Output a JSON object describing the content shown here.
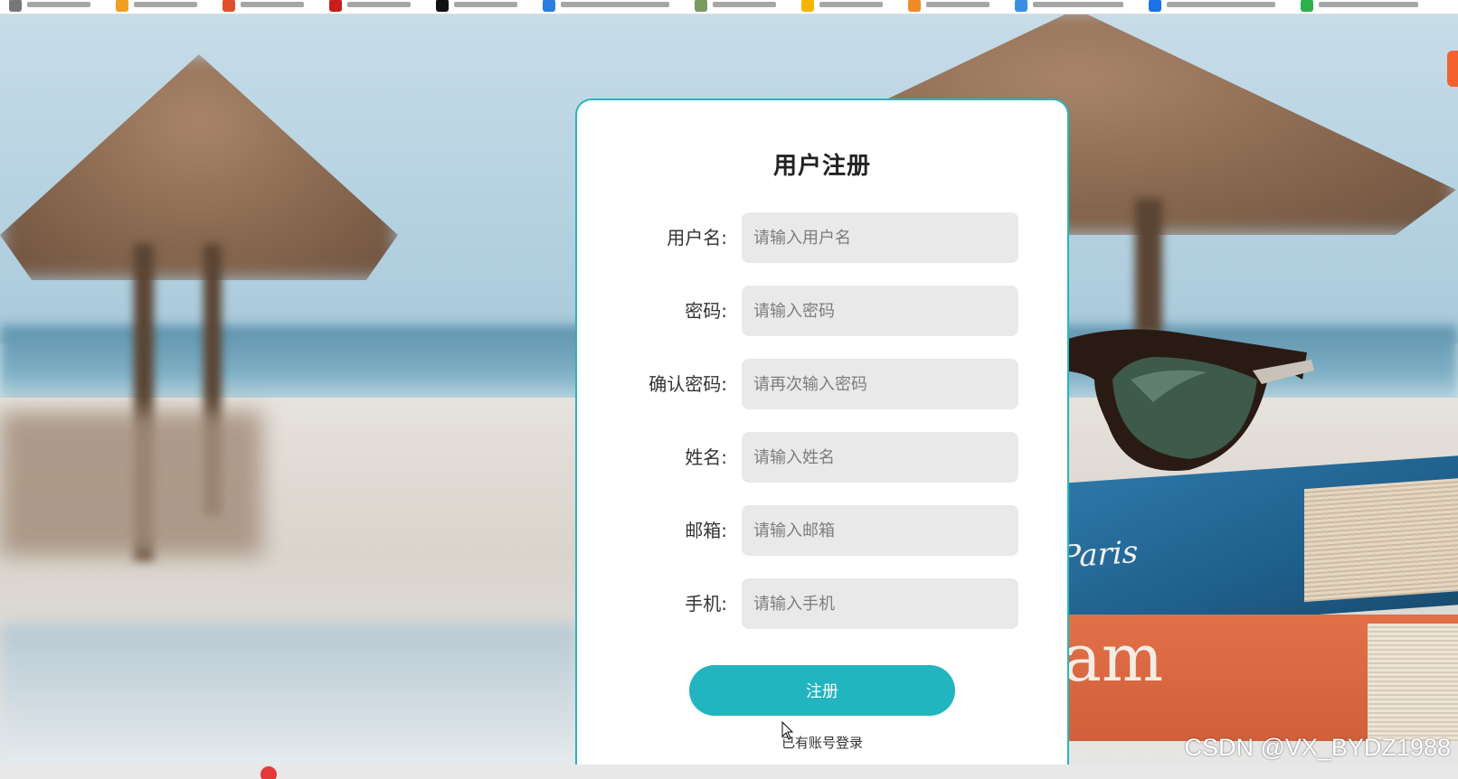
{
  "register_form": {
    "title": "用户注册",
    "fields": [
      {
        "label": "用户名:",
        "placeholder": "请输入用户名",
        "value": ""
      },
      {
        "label": "密码:",
        "placeholder": "请输入密码",
        "value": ""
      },
      {
        "label": "确认密码:",
        "placeholder": "请再次输入密码",
        "value": ""
      },
      {
        "label": "姓名:",
        "placeholder": "请输入姓名",
        "value": ""
      },
      {
        "label": "邮箱:",
        "placeholder": "请输入邮箱",
        "value": ""
      },
      {
        "label": "手机:",
        "placeholder": "请输入手机",
        "value": ""
      }
    ],
    "submit_label": "注册",
    "login_link_label": "已有账号登录"
  },
  "background": {
    "book_blue_text": "Paris",
    "book_orange_text": "am"
  },
  "watermark": "CSDN @VX_BYDZ1988",
  "colors": {
    "accent": "#20b5bf",
    "card_border": "#2bb3bd",
    "input_bg": "#e9e9e9",
    "card_bg": "#ffffff"
  }
}
